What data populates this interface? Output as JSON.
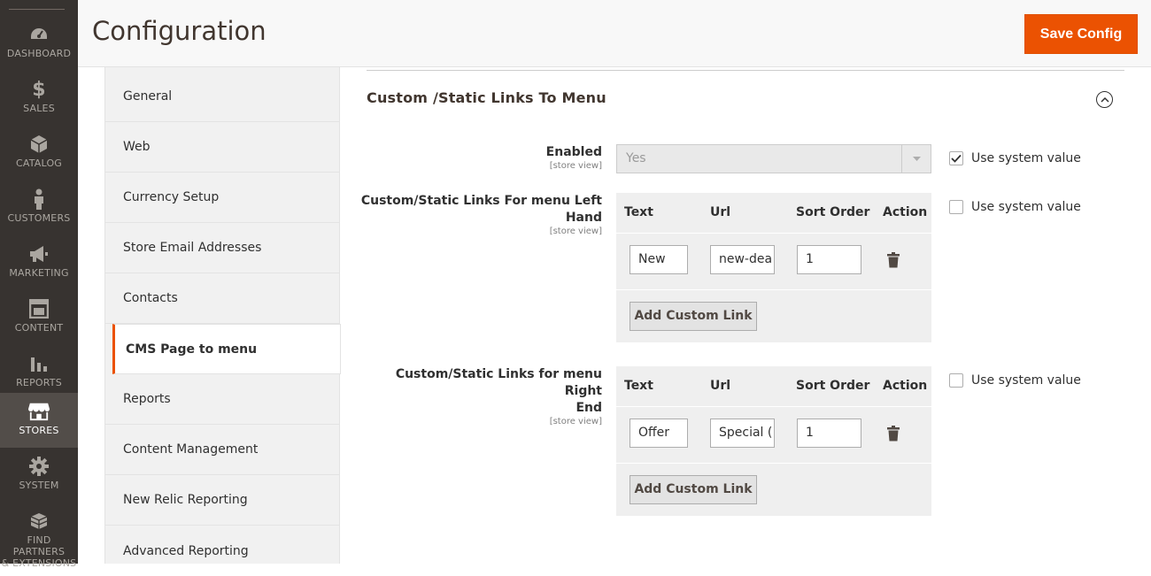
{
  "nav": {
    "items": [
      {
        "label": "DASHBOARD",
        "icon": "dashboard-icon"
      },
      {
        "label": "SALES",
        "icon": "dollar-icon"
      },
      {
        "label": "CATALOG",
        "icon": "box-icon"
      },
      {
        "label": "CUSTOMERS",
        "icon": "person-icon"
      },
      {
        "label": "MARKETING",
        "icon": "megaphone-icon"
      },
      {
        "label": "CONTENT",
        "icon": "content-icon"
      },
      {
        "label": "REPORTS",
        "icon": "bar-chart-icon"
      },
      {
        "label": "STORES",
        "icon": "store-icon",
        "active": true
      },
      {
        "label": "SYSTEM",
        "icon": "gear-icon"
      },
      {
        "label_line1": "FIND PARTNERS",
        "label_line2": "& EXTENSIONS",
        "icon": "blocks-icon"
      }
    ]
  },
  "header": {
    "title": "Configuration",
    "save_label": "Save Config"
  },
  "tabs": [
    {
      "label": "General"
    },
    {
      "label": "Web"
    },
    {
      "label": "Currency Setup"
    },
    {
      "label": "Store Email Addresses"
    },
    {
      "label": "Contacts"
    },
    {
      "label": "CMS Page to menu",
      "active": true
    },
    {
      "label": "Reports"
    },
    {
      "label": "Content Management"
    },
    {
      "label": "New Relic Reporting"
    },
    {
      "label": "Advanced Reporting"
    }
  ],
  "section": {
    "title": "Custom /Static Links To Menu",
    "enabled": {
      "label": "Enabled",
      "scope": "[store view]",
      "value": "Yes",
      "use_system_value": "Use system value",
      "checked": true
    },
    "left_hand": {
      "label_line1": "Custom/Static Links For menu Left",
      "label_line2": "Hand",
      "scope": "[store view]",
      "use_system_value": "Use system value",
      "checked": false,
      "columns": [
        "Text",
        "Url",
        "Sort Order",
        "Action"
      ],
      "row": {
        "text": "New",
        "url": "new-dea",
        "sort_order": "1"
      },
      "add_button": "Add Custom Link"
    },
    "right_end": {
      "label_line1": "Custom/Static Links for menu Right",
      "label_line2": "End",
      "scope": "[store view]",
      "use_system_value": "Use system value",
      "checked": false,
      "columns": [
        "Text",
        "Url",
        "Sort Order",
        "Action"
      ],
      "row": {
        "text": "Offer",
        "url": "Special (",
        "sort_order": "1"
      },
      "add_button": "Add Custom Link"
    }
  },
  "colors": {
    "nav_bg": "#373330",
    "accent": "#eb5202"
  }
}
